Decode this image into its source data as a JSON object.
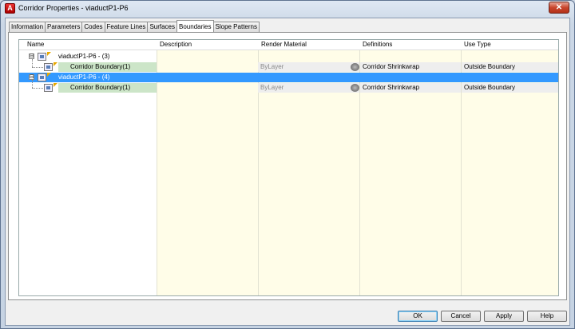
{
  "window": {
    "title": "Corridor Properties - viaductP1-P6",
    "app_icon_letter": "A",
    "close_glyph": "✕"
  },
  "tabs": [
    "Information",
    "Parameters",
    "Codes",
    "Feature Lines",
    "Surfaces",
    "Boundaries",
    "Slope Patterns"
  ],
  "active_tab": "Boundaries",
  "columns": [
    "Name",
    "Description",
    "Render Material",
    "Definitions",
    "Use Type"
  ],
  "rows": [
    {
      "name": "viaductP1-P6 - (3)",
      "level": 0,
      "expand": "⊟",
      "description": "",
      "material": "",
      "definition": "",
      "use_type": ""
    },
    {
      "name": "Corridor Boundary(1)",
      "level": 1,
      "description": "",
      "material": "ByLayer",
      "definition": "Corridor Shrinkwrap",
      "use_type": "Outside Boundary"
    },
    {
      "name": "viaductP1-P6 - (4)",
      "level": 0,
      "expand": "⊟",
      "selected": true,
      "description": "",
      "material": "",
      "definition": "",
      "use_type": ""
    },
    {
      "name": "Corridor Boundary(1)",
      "level": 1,
      "description": "",
      "material": "ByLayer",
      "definition": "Corridor Shrinkwrap",
      "use_type": "Outside Boundary"
    }
  ],
  "buttons": {
    "ok": "OK",
    "cancel": "Cancel",
    "apply": "Apply",
    "help": "Help"
  },
  "colors": {
    "selection": "#3399ff",
    "row_green": "#cce5c8",
    "column_tint": "#fffde8"
  }
}
